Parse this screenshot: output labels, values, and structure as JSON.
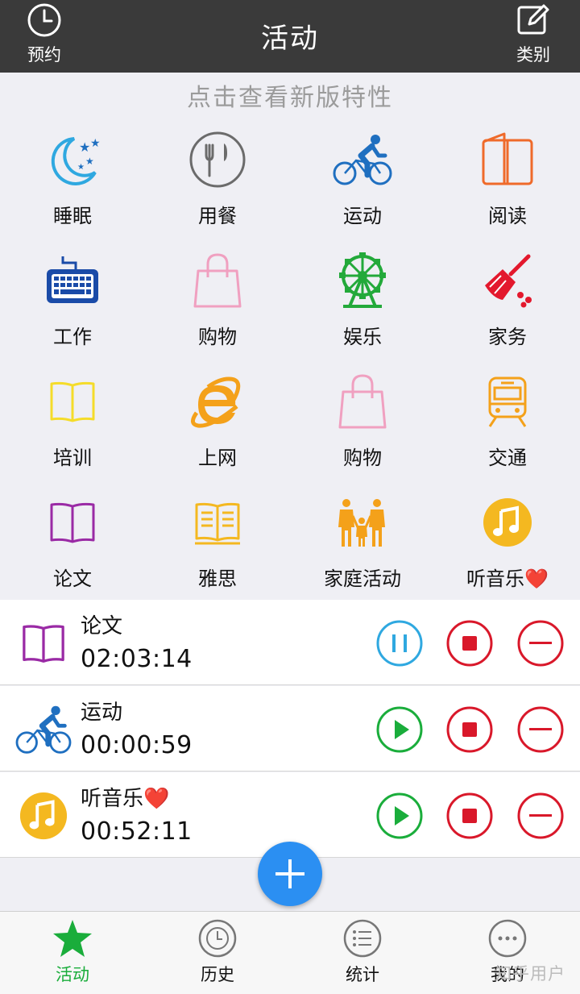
{
  "header": {
    "title": "活动",
    "left_label": "预约",
    "right_label": "类别",
    "left_icon": "clock-icon",
    "right_icon": "edit-icon"
  },
  "notice": "点击查看新版特性",
  "categories": [
    {
      "label": "睡眠",
      "icon": "moon-stars-icon",
      "color": "#2fa8e0"
    },
    {
      "label": "用餐",
      "icon": "fork-knife-icon",
      "color": "#6b6b6b"
    },
    {
      "label": "运动",
      "icon": "cyclist-icon",
      "color": "#1f6fc0"
    },
    {
      "label": "阅读",
      "icon": "book-open-icon",
      "color": "#ef6a2a"
    },
    {
      "label": "工作",
      "icon": "keyboard-icon",
      "color": "#1a4ba8"
    },
    {
      "label": "购物",
      "icon": "shopping-bag-icon",
      "color": "#f0a0c0"
    },
    {
      "label": "娱乐",
      "icon": "ferris-wheel-icon",
      "color": "#23a93a"
    },
    {
      "label": "家务",
      "icon": "broom-icon",
      "color": "#e3182d"
    },
    {
      "label": "培训",
      "icon": "book-icon",
      "color": "#f5dc2a"
    },
    {
      "label": "上网",
      "icon": "browser-e-icon",
      "color": "#f4a11a"
    },
    {
      "label": "购物",
      "icon": "shopping-bag-icon",
      "color": "#f0a0c0"
    },
    {
      "label": "交通",
      "icon": "train-icon",
      "color": "#f4a11a"
    },
    {
      "label": "论文",
      "icon": "book-icon",
      "color": "#9a2aa5"
    },
    {
      "label": "雅思",
      "icon": "book-lines-icon",
      "color": "#f4b820"
    },
    {
      "label": "家庭活动",
      "icon": "family-icon",
      "color": "#f4a11a"
    },
    {
      "label": "听音乐",
      "icon": "music-note-icon",
      "color": "#f4b820",
      "suffix": "❤️"
    }
  ],
  "running": [
    {
      "name": "论文",
      "time": "02:03:14",
      "icon": "book-icon",
      "state": "running"
    },
    {
      "name": "运动",
      "time": "00:00:59",
      "icon": "cyclist-icon",
      "state": "paused"
    },
    {
      "name": "听音乐",
      "suffix": "❤️",
      "time": "00:52:11",
      "icon": "music-note-icon",
      "state": "paused"
    }
  ],
  "colors": {
    "pause": "#2fa8e0",
    "play": "#1aad3b",
    "stop": "#d9182a",
    "remove": "#d9182a",
    "fab": "#2b8ff2",
    "tab_active": "#1aad3b"
  },
  "tabs": [
    {
      "label": "活动",
      "icon": "star-icon"
    },
    {
      "label": "历史",
      "icon": "history-icon"
    },
    {
      "label": "统计",
      "icon": "list-icon"
    },
    {
      "label": "我的",
      "icon": "more-icon"
    }
  ],
  "watermark": "知乎用户"
}
